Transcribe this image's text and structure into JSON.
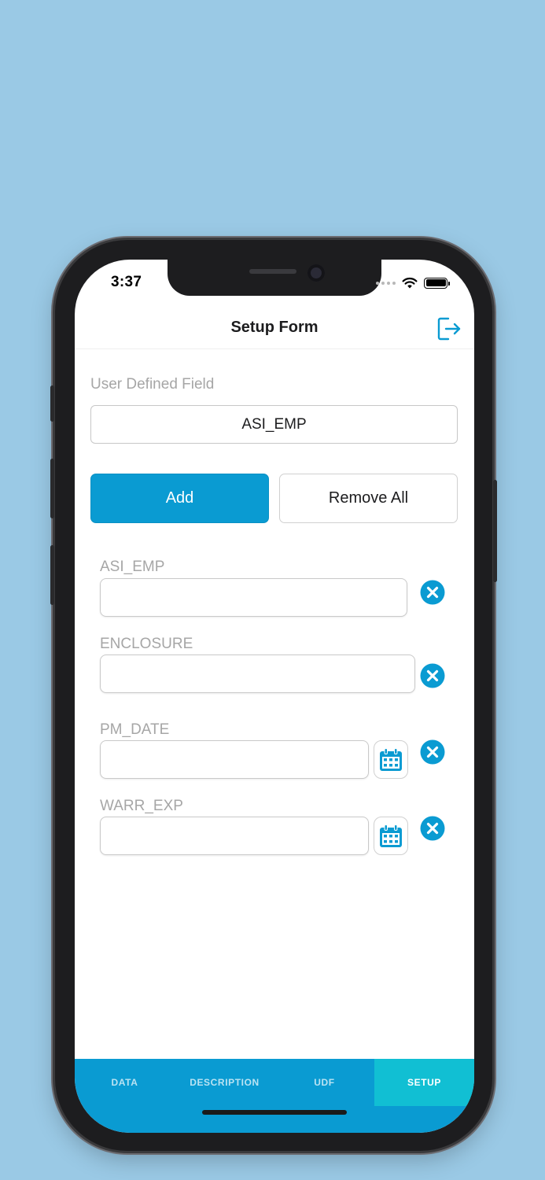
{
  "status_bar": {
    "time": "3:37"
  },
  "nav": {
    "title": "Setup Form"
  },
  "udf": {
    "label": "User Defined Field",
    "value": "ASI_EMP"
  },
  "buttons": {
    "add": "Add",
    "remove_all": "Remove All"
  },
  "fields": [
    {
      "label": "ASI_EMP",
      "value": "",
      "has_calendar": false
    },
    {
      "label": "ENCLOSURE",
      "value": "",
      "has_calendar": false
    },
    {
      "label": "PM_DATE",
      "value": "",
      "has_calendar": true
    },
    {
      "label": "WARR_EXP",
      "value": "",
      "has_calendar": true
    }
  ],
  "tabs": [
    {
      "label": "DATA",
      "active": false
    },
    {
      "label": "DESCRIPTION",
      "active": false
    },
    {
      "label": "UDF",
      "active": false
    },
    {
      "label": "SETUP",
      "active": true
    }
  ],
  "colors": {
    "background": "#9ac9e5",
    "accent": "#0a9bd2",
    "active_tab": "#11bfd3",
    "label_gray": "#a6a6a6"
  },
  "icons": {
    "logout": "logout-icon",
    "calendar": "calendar-icon",
    "remove": "close-circle-icon"
  }
}
